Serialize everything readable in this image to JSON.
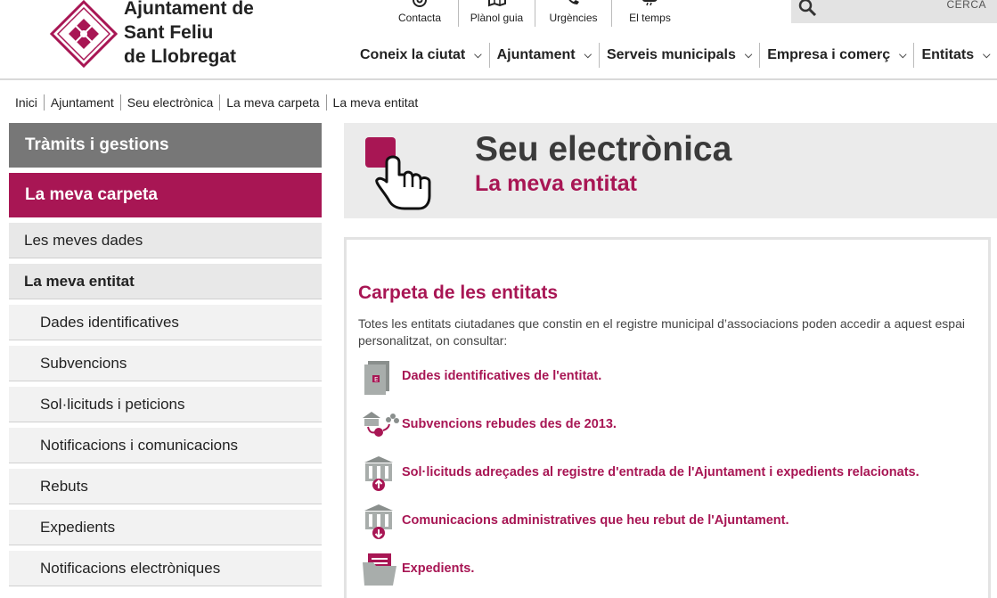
{
  "brand": {
    "line1": "Ajuntament de",
    "line2": "Sant Feliu",
    "line3": "de Llobregat",
    "color": "#a81654"
  },
  "quicklinks": [
    {
      "label": "Contacta",
      "icon": "at-icon"
    },
    {
      "label": "Plànol guia",
      "icon": "map-icon"
    },
    {
      "label": "Urgències",
      "icon": "phone-icon"
    },
    {
      "label": "El temps",
      "icon": "weather-icon"
    }
  ],
  "search": {
    "label": "CERCA",
    "icon": "search-icon"
  },
  "mainnav": [
    {
      "label": "Coneix la ciutat"
    },
    {
      "label": "Ajuntament"
    },
    {
      "label": "Serveis municipals"
    },
    {
      "label": "Empresa i comerç"
    },
    {
      "label": "Entitats"
    }
  ],
  "breadcrumb": [
    "Inici",
    "Ajuntament",
    "Seu electrònica",
    "La meva carpeta",
    "La meva entitat"
  ],
  "sidebar": {
    "section1": "Tràmits i gestions",
    "section2": "La meva carpeta",
    "items": [
      "Les meves dades",
      "La meva entitat",
      "Dades identificatives",
      "Subvencions",
      "Sol·licituds i peticions",
      "Notificacions i comunicacions",
      "Rebuts",
      "Expedients",
      "Notificacions electròniques"
    ]
  },
  "header_box": {
    "title": "Seu electrònica",
    "subtitle": "La meva entitat"
  },
  "content": {
    "heading": "Carpeta de les entitats",
    "intro": "Totes les entitats ciutadanes que constin en el registre municipal d’associacions poden accedir a aquest espai personalitzat, on consultar:",
    "links": [
      {
        "label": "Dades identificatives de l'entitat.",
        "icon": "document-icon"
      },
      {
        "label": "Subvencions rebudes des de 2013.",
        "icon": "grants-icon"
      },
      {
        "label": "Sol·licituds adreçades al registre d'entrada de l'Ajuntament i expedients relacionats.",
        "icon": "building-upload-icon"
      },
      {
        "label": "Comunicacions administratives que heu rebut de l'Ajuntament.",
        "icon": "building-download-icon"
      },
      {
        "label": "Expedients.",
        "icon": "folder-icon"
      }
    ]
  }
}
